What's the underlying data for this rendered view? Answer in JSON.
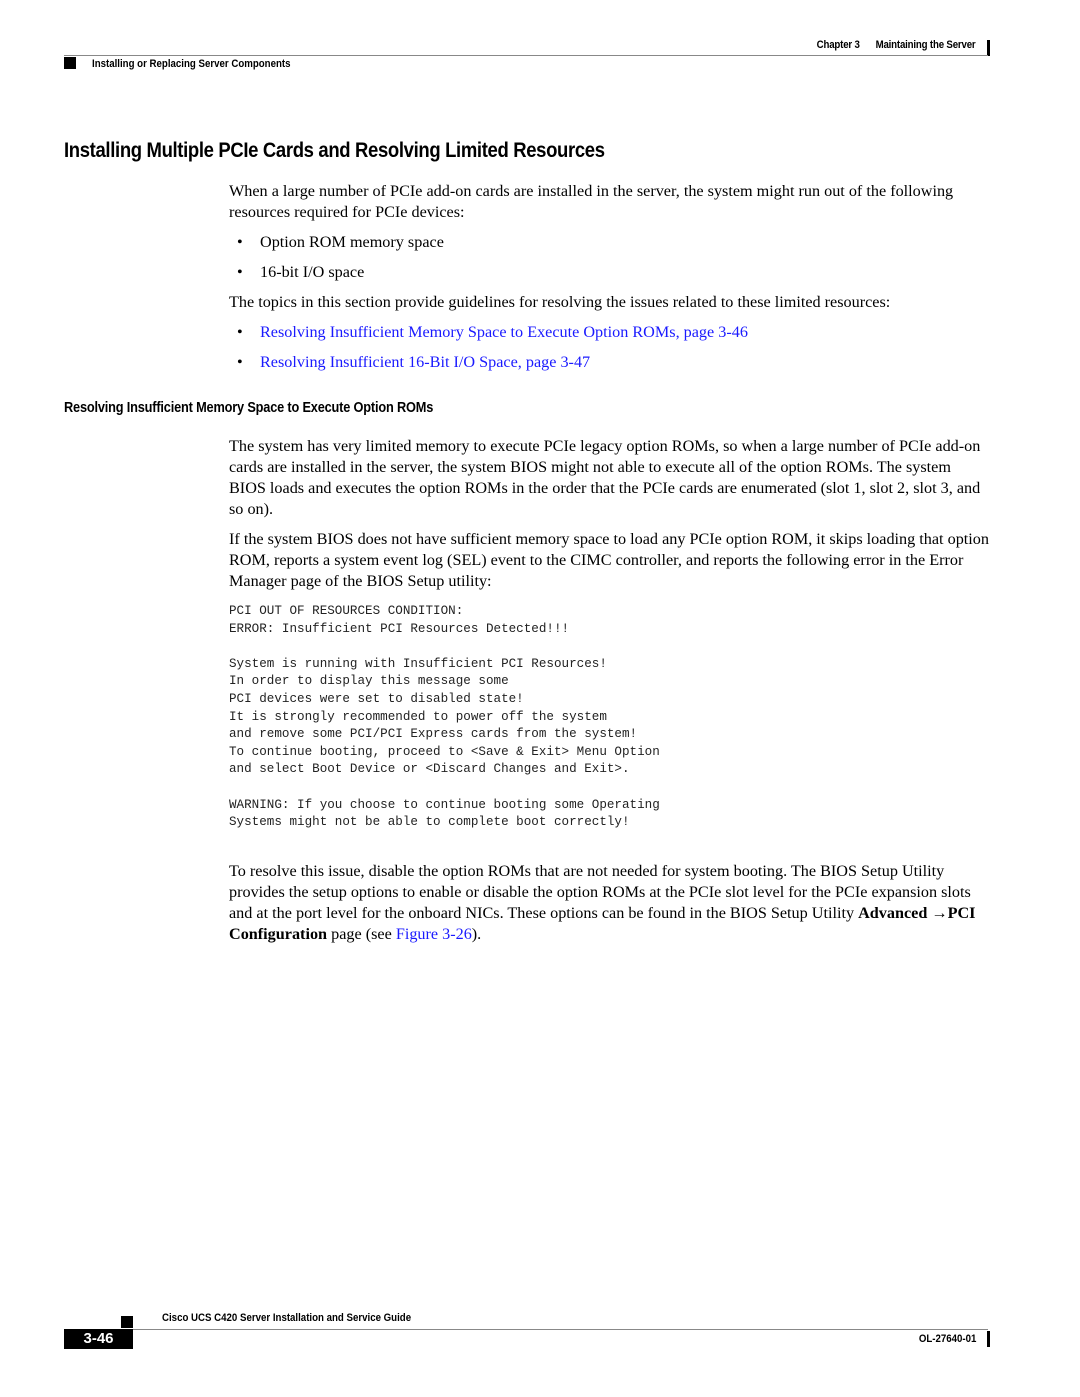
{
  "header": {
    "chapter_label": "Chapter 3",
    "chapter_title": "Maintaining the Server",
    "section": "Installing or Replacing Server Components"
  },
  "main": {
    "title": "Installing Multiple PCIe Cards and Resolving Limited Resources",
    "intro": "When a large number of PCIe add-on cards are installed in the server, the system might run out of the following resources required for PCIe devices:",
    "resources": [
      "Option ROM memory space",
      "16-bit I/O space"
    ],
    "topics_intro": "The topics in this section provide guidelines for resolving the issues related to these limited resources:",
    "topic_links": [
      "Resolving Insufficient Memory Space to Execute Option ROMs, page 3-46",
      "Resolving Insufficient 16-Bit I/O Space, page 3-47"
    ],
    "subsection": {
      "title": "Resolving Insufficient Memory Space to Execute Option ROMs",
      "para1": "The system has very limited memory to execute PCIe legacy option ROMs, so when a large number of PCIe add-on cards are installed in the server, the system BIOS might not able to execute all of the option ROMs. The system BIOS loads and executes the option ROMs in the order that the PCIe cards are enumerated (slot 1, slot 2, slot 3, and so on).",
      "para2": "If the system BIOS does not have sufficient memory space to load any PCIe option ROM, it skips loading that option ROM, reports a system event log (SEL) event to the CIMC controller, and reports the following error in the Error Manager page of the BIOS Setup utility:",
      "code_lines": [
        "PCI OUT OF RESOURCES CONDITION:",
        "ERROR: Insufficient PCI Resources Detected!!!",
        "",
        "System is running with Insufficient PCI Resources!",
        "In order to display this message some",
        "PCI devices were set to disabled state!",
        "It is strongly recommended to power off the system",
        "and remove some PCI/PCI Express cards from the system!",
        "To continue booting, proceed to <Save & Exit> Menu Option",
        "and select Boot Device or <Discard Changes and Exit>.",
        "",
        "WARNING: If you choose to continue booting some Operating",
        "Systems might not be able to complete boot correctly!"
      ],
      "para3_text": "To resolve this issue, disable the option ROMs that are not needed for system booting. The BIOS Setup Utility provides the setup options to enable or disable the option ROMs at the PCIe slot level for the PCIe expansion slots and at the port level for the onboard NICs. These options can be found in the BIOS Setup Utility ",
      "para3_bold": "Advanced →PCI Configuration",
      "para3_mid": " page (see ",
      "para3_link": "Figure 3-26",
      "para3_end": ")."
    }
  },
  "footer": {
    "guide_title": "Cisco UCS C420 Server Installation and Service Guide",
    "page_number": "3-46",
    "doc_number": "OL-27640-01"
  },
  "colors": {
    "link": "#1a1aff",
    "text": "#000000",
    "rule": "#888888"
  }
}
